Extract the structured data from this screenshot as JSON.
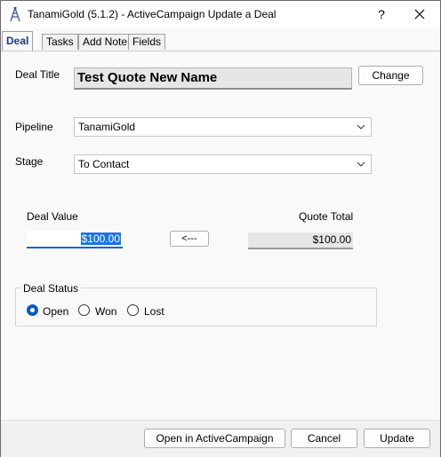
{
  "window": {
    "title": "TanamiGold (5.1.2) - ActiveCampaign Update a Deal",
    "help_label": "?",
    "close_icon": "close-icon"
  },
  "tabs": [
    {
      "label": "Deal",
      "active": true
    },
    {
      "label": "Tasks",
      "active": false
    },
    {
      "label": "Add Note",
      "active": false
    },
    {
      "label": "Fields",
      "active": false
    }
  ],
  "deal": {
    "title_label": "Deal Title",
    "title_value": "Test Quote New Name",
    "change_label": "Change",
    "pipeline_label": "Pipeline",
    "pipeline_value": "TanamiGold",
    "stage_label": "Stage",
    "stage_value": "To Contact",
    "value_label": "Deal Value",
    "value_value": "$100.00",
    "copy_label": "<---",
    "quote_total_label": "Quote Total",
    "quote_total_value": "$100.00",
    "status_group_label": "Deal Status",
    "status_options": [
      {
        "label": "Open",
        "checked": true
      },
      {
        "label": "Won",
        "checked": false
      },
      {
        "label": "Lost",
        "checked": false
      }
    ]
  },
  "footer": {
    "open_label": "Open in ActiveCampaign",
    "cancel_label": "Cancel",
    "update_label": "Update"
  },
  "colors": {
    "accent": "#0a5bc4",
    "active_tab_text": "#1a3a8a",
    "selection": "#1a73e8"
  }
}
